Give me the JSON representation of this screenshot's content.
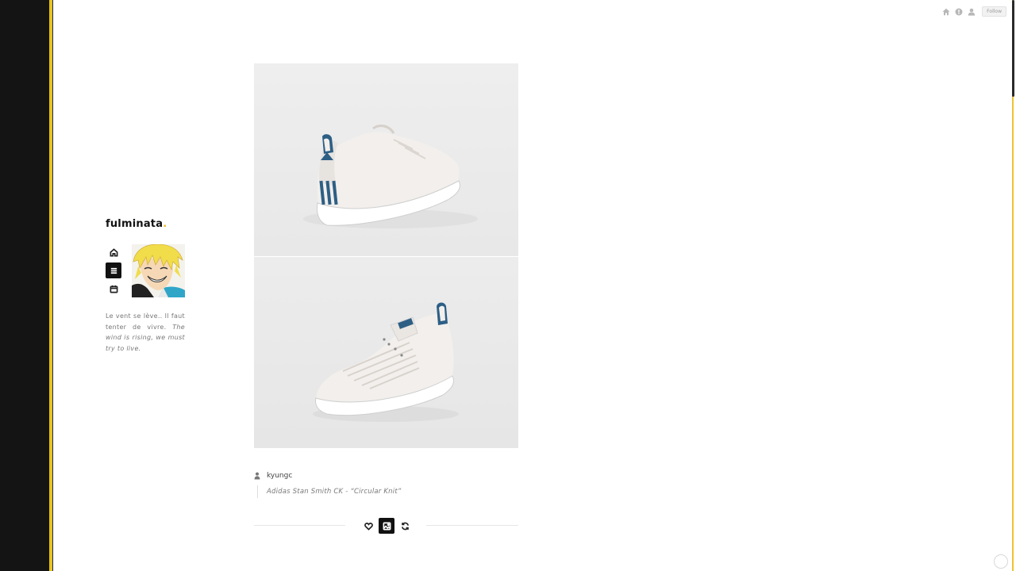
{
  "topbar": {
    "follow_label": "Follow",
    "icons": [
      "home-icon",
      "help-icon",
      "user-icon"
    ]
  },
  "blog": {
    "title": "fulminata",
    "title_dot": ".",
    "description_fr": "Le vent se lève.. Il faut tenter de vivre.",
    "description_en": "The wind is rising, we must try to live."
  },
  "nav": {
    "items": [
      {
        "name": "home",
        "icon": "home-icon"
      },
      {
        "name": "menu",
        "icon": "menu-icon",
        "active": true
      },
      {
        "name": "archive",
        "icon": "calendar-icon"
      }
    ]
  },
  "post": {
    "author": "kyungc",
    "caption": "Adidas Stan Smith CK - “Circular Knit”",
    "photos": [
      "stan-smith-back-view",
      "stan-smith-front-view"
    ],
    "actions": [
      {
        "name": "like",
        "icon": "heart-icon"
      },
      {
        "name": "photo",
        "icon": "image-icon",
        "active": true
      },
      {
        "name": "reblog",
        "icon": "refresh-icon"
      }
    ]
  },
  "colors": {
    "accent": "#e8c21a",
    "sidebar": "#141414",
    "accent_blue": "#2d5f85"
  }
}
